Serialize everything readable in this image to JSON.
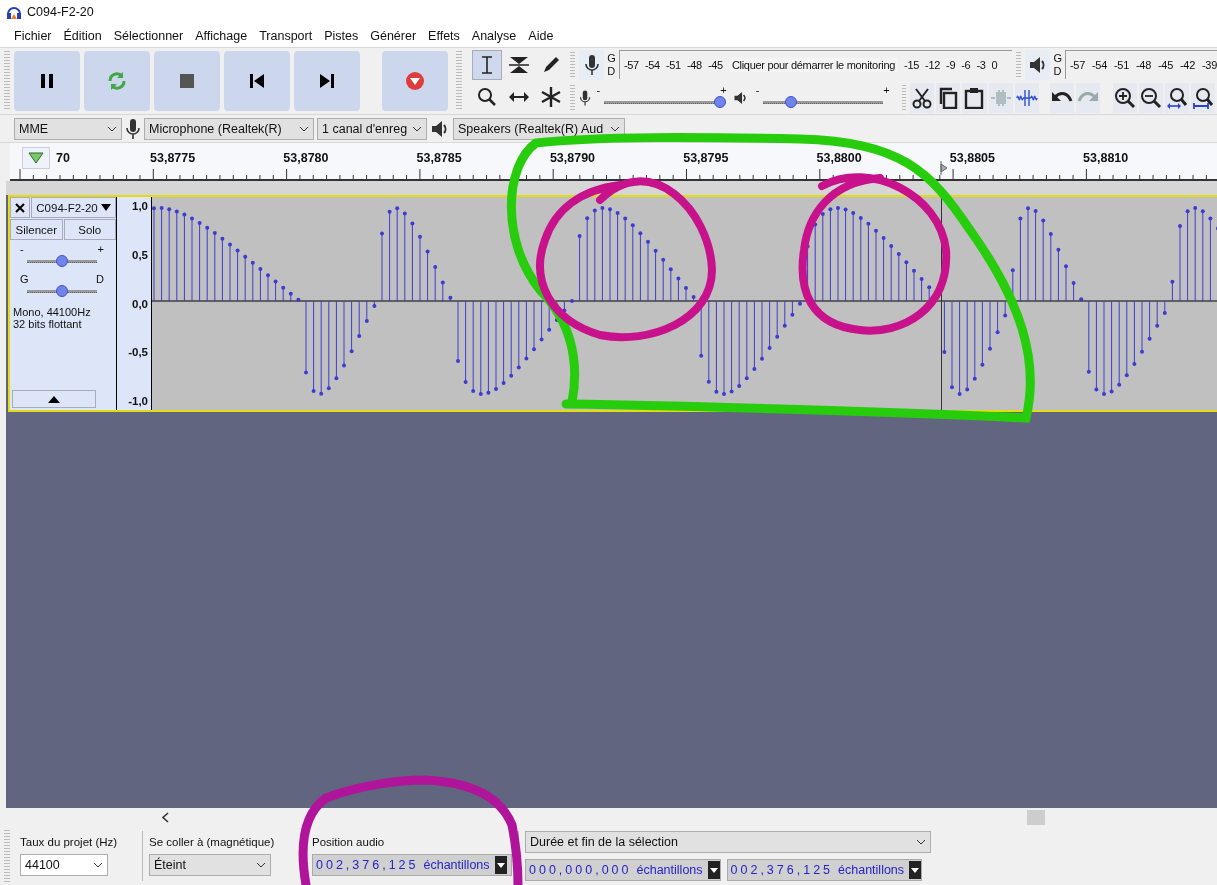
{
  "window": {
    "title": "C094-F2-20"
  },
  "menu": [
    "Fichier",
    "Édition",
    "Sélectionner",
    "Affichage",
    "Transport",
    "Pistes",
    "Générer",
    "Effets",
    "Analyse",
    "Aide"
  ],
  "tools": [
    {
      "kind": "select",
      "selected": true
    },
    {
      "kind": "envelope",
      "selected": false
    },
    {
      "kind": "draw",
      "selected": false
    },
    {
      "kind": "zoom",
      "selected": false
    },
    {
      "kind": "timeshift",
      "selected": false
    },
    {
      "kind": "multi",
      "selected": false
    }
  ],
  "record_meter": {
    "channels": [
      "G",
      "D"
    ],
    "scale": [
      "-57",
      "-54",
      "-51",
      "-48",
      "-45"
    ],
    "prompt": "Cliquer pour démarrer le monitoring",
    "scale_end": [
      "-15",
      "-12",
      "-9",
      "-6",
      "-3",
      "0"
    ]
  },
  "playback_meter": {
    "channels": [
      "G",
      "D"
    ],
    "scale": [
      "-57",
      "-54",
      "-51",
      "-48",
      "-45",
      "-42",
      "-39"
    ]
  },
  "record_volume": {
    "minus": "-",
    "plus": "+",
    "level": 1.0
  },
  "playback_volume": {
    "minus": "-",
    "plus": "+",
    "level": 0.24
  },
  "edit_tools": [
    {
      "kind": "cut",
      "disabled": false
    },
    {
      "kind": "copy",
      "disabled": false
    },
    {
      "kind": "paste",
      "disabled": false
    },
    {
      "kind": "trim",
      "disabled": true
    },
    {
      "kind": "silence",
      "disabled": false
    }
  ],
  "history_tools": [
    {
      "kind": "undo",
      "disabled": false
    },
    {
      "kind": "redo",
      "disabled": true
    }
  ],
  "zoom_tools": [
    {
      "kind": "zoom-in"
    },
    {
      "kind": "zoom-out"
    },
    {
      "kind": "zoom-selection"
    },
    {
      "kind": "zoom-fit"
    }
  ],
  "device_bar": {
    "host": "MME",
    "input": "Microphone (Realtek(R)",
    "channels": "1 canal d'enreg",
    "output": "Speakers (Realtek(R) Aud"
  },
  "timeline": {
    "labels": [
      "70",
      "53,8775",
      "53,8780",
      "53,8785",
      "53,8790",
      "53,8795",
      "53,8800",
      "53,8805",
      "53,8810"
    ]
  },
  "track": {
    "name": "C094-F2-20",
    "selected": true,
    "mute": "Silencer",
    "solo": "Solo",
    "gain": {
      "minus": "-",
      "plus": "+",
      "level": 0.5
    },
    "pan": {
      "left": "G",
      "right": "D",
      "level": 0.5
    },
    "info": [
      "Mono, 44100Hz",
      "32 bits flottant"
    ],
    "scale": [
      "1,0",
      "0,5",
      "0,0",
      "-0,5",
      "-1,0"
    ]
  },
  "selection_bar": {
    "rate_label": "Taux du projet (Hz)",
    "rate": "44100",
    "snap_label": "Se coller à (magnétique)",
    "snap": "Éteint",
    "position_label": "Position audio",
    "position": {
      "value": "002,376,125",
      "unit": "échantillons"
    },
    "selection_label": "Durée et fin de la sélection",
    "start": {
      "value": "000,000,000",
      "unit": "échantillons"
    },
    "end": {
      "value": "002,376,125",
      "unit": "échantillons"
    }
  },
  "annotations": [
    {
      "kind": "loop",
      "color": "#27cc0c"
    },
    {
      "kind": "circle",
      "color": "#c8128c"
    },
    {
      "kind": "circle",
      "color": "#c8128c"
    },
    {
      "kind": "arc",
      "color": "#b0149a"
    }
  ]
}
